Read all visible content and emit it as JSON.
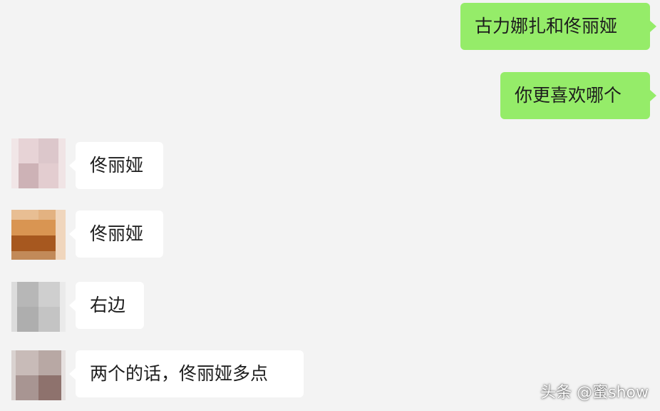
{
  "messages": [
    {
      "side": "right",
      "text": "古力娜扎和佟丽娅"
    },
    {
      "side": "right",
      "text": "你更喜欢哪个"
    },
    {
      "side": "left",
      "text": "佟丽娅"
    },
    {
      "side": "left",
      "text": "佟丽娅"
    },
    {
      "side": "left",
      "text": "右边"
    },
    {
      "side": "left",
      "text": "两个的话，佟丽娅多点"
    }
  ],
  "watermark": "头条 @蜜show",
  "colors": {
    "background": "#f3f3f3",
    "sent_bubble": "#95ec69",
    "received_bubble": "#ffffff"
  }
}
